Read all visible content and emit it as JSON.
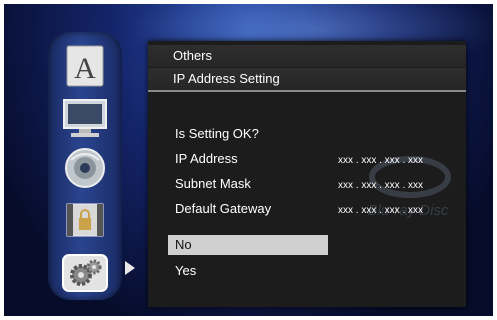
{
  "menu": {
    "header": "Others",
    "subheader": "IP Address Setting",
    "question": "Is Setting OK?",
    "fields": [
      {
        "label": "IP Address",
        "value": "xxx . xxx . xxx . xxx"
      },
      {
        "label": "Subnet Mask",
        "value": "xxx . xxx . xxx . xxx"
      },
      {
        "label": "Default Gateway",
        "value": "xxx . xxx . xxx . xxx"
      }
    ],
    "options": [
      {
        "label": "No",
        "selected": true
      },
      {
        "label": "Yes",
        "selected": false
      }
    ]
  },
  "watermark": "Blu-ray Disc",
  "sidebar": {
    "items": [
      {
        "icon": "language-icon",
        "letter": "A"
      },
      {
        "icon": "display-icon"
      },
      {
        "icon": "audio-disc-icon"
      },
      {
        "icon": "parental-lock-icon"
      },
      {
        "icon": "settings-gears-icon",
        "active": true
      }
    ]
  },
  "colors": {
    "selection": "#cfcfcf",
    "panel": "#1c1c1c",
    "background": "#14246a"
  }
}
